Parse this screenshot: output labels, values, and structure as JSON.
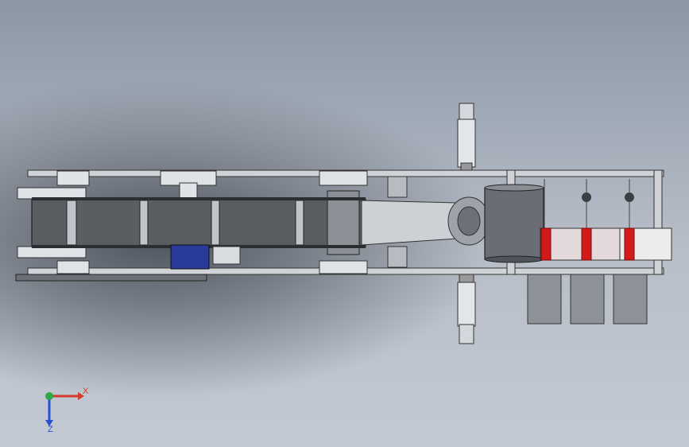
{
  "triad": {
    "x_label": "X",
    "z_label": "Z",
    "colors": {
      "x": "#d23a2a",
      "y": "#2fa84a",
      "z": "#2a4fd2"
    }
  },
  "model": {
    "frame_color": "#c8ccd2",
    "belt_color": "#5a5d62",
    "spring_color": "#d11a1a",
    "motor_color": "#2a3a9a"
  }
}
